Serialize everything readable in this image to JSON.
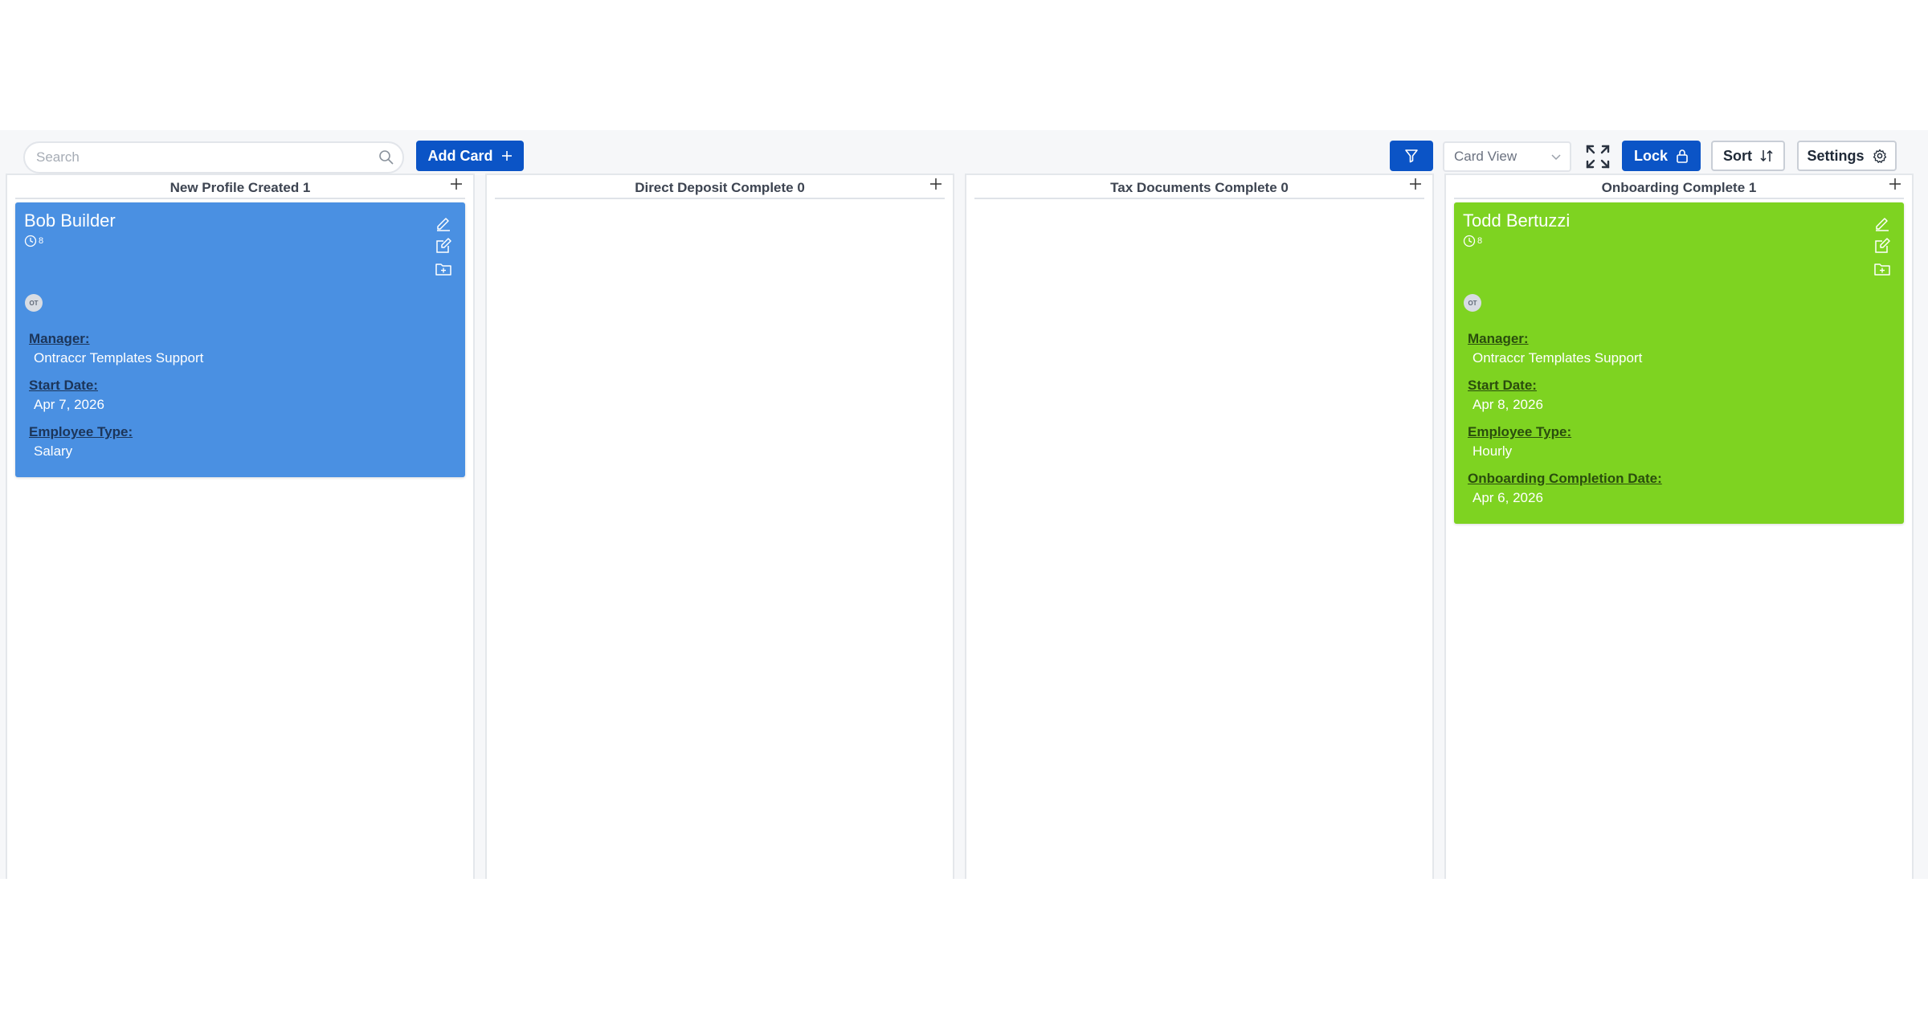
{
  "toolbar": {
    "search_placeholder": "Search",
    "add_card_label": "Add Card",
    "view_select_value": "Card View",
    "lock_label": "Lock",
    "sort_label": "Sort",
    "settings_label": "Settings"
  },
  "colors": {
    "primary": "#0b54c6",
    "card_blue": "#4a90e2",
    "card_green": "#7ed321"
  },
  "columns": [
    {
      "title": "New Profile Created 1"
    },
    {
      "title": "Direct Deposit Complete 0"
    },
    {
      "title": "Tax Documents Complete 0"
    },
    {
      "title": "Onboarding Complete 1"
    }
  ],
  "cards": [
    {
      "title": "Bob Builder",
      "clock_count": "8",
      "avatar": "OT",
      "fields": [
        {
          "label": "Manager:",
          "value": "Ontraccr Templates Support"
        },
        {
          "label": "Start Date:",
          "value": "Apr 7, 2026"
        },
        {
          "label": "Employee Type:",
          "value": "Salary"
        }
      ]
    },
    {
      "title": "Todd Bertuzzi",
      "clock_count": "8",
      "avatar": "OT",
      "fields": [
        {
          "label": "Manager:",
          "value": "Ontraccr Templates Support"
        },
        {
          "label": "Start Date:",
          "value": "Apr 8, 2026"
        },
        {
          "label": "Employee Type:",
          "value": "Hourly"
        },
        {
          "label": "Onboarding Completion Date:",
          "value": "Apr 6, 2026"
        }
      ]
    }
  ]
}
